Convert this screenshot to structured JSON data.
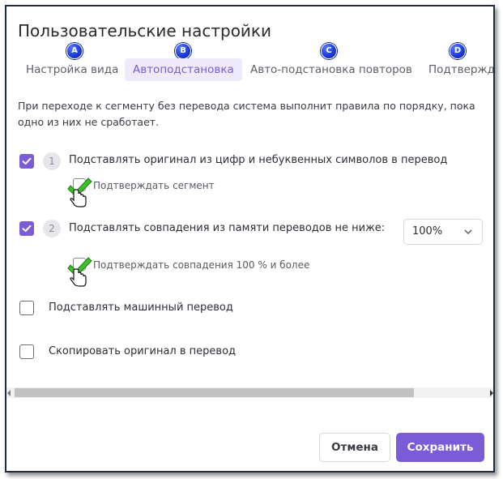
{
  "dialog": {
    "title": "Пользовательские настройки"
  },
  "tabs": [
    {
      "label": "Настройка вида",
      "badge": "A",
      "active": false
    },
    {
      "label": "Автоподстановка",
      "badge": "B",
      "active": true
    },
    {
      "label": "Авто-подстановка повторов",
      "badge": "C",
      "active": false
    },
    {
      "label": "Подтвержд",
      "badge": "D",
      "active": false
    }
  ],
  "description": "При переходе к сегменту без перевода система выполнит правила по порядку, пока одно из них не сработает.",
  "rules": [
    {
      "number": "1",
      "checked": true,
      "label": "Подставлять оригинал из цифр и небуквенных символов в перевод",
      "sub_option": {
        "label": "Подтверждать сегмент",
        "checked": false
      }
    },
    {
      "number": "2",
      "checked": true,
      "label": "Подставлять совпадения из памяти переводов не ниже:",
      "select_value": "100%",
      "sub_option": {
        "label": "Подтверждать совпадения 100 % и более",
        "checked": false
      }
    }
  ],
  "options": [
    {
      "label": "Подставлять машинный перевод",
      "checked": false
    },
    {
      "label": "Скопировать оригинал в перевод",
      "checked": false
    }
  ],
  "buttons": {
    "cancel": "Отмена",
    "save": "Сохранить"
  },
  "colors": {
    "accent": "#7b5bd6",
    "badge": "#1b3be0",
    "check_overlay": "#3fbf2a"
  }
}
